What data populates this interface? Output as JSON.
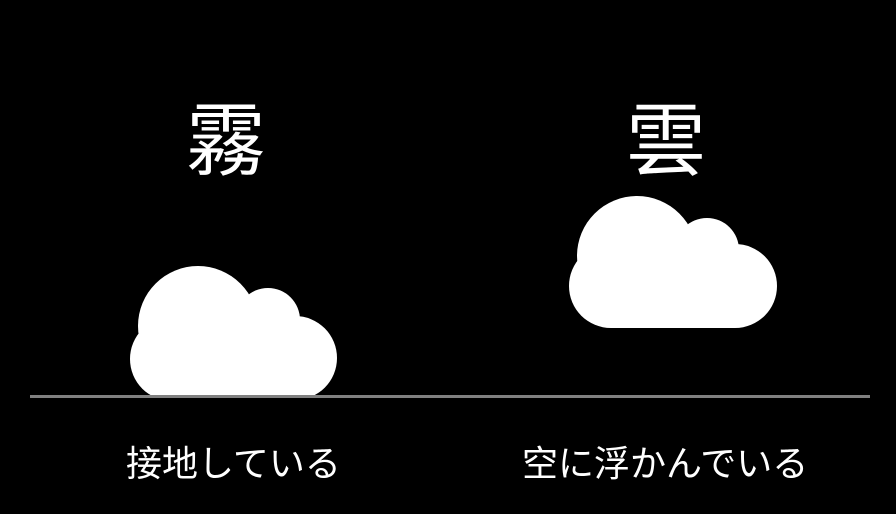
{
  "colors": {
    "background": "#000000",
    "text": "#ffffff",
    "cloud": "#ffffff",
    "ground": "#808080"
  },
  "left": {
    "title": "霧",
    "caption": "接地している",
    "icon": "cloud-icon"
  },
  "right": {
    "title": "雲",
    "caption": "空に浮かんでいる",
    "icon": "cloud-icon"
  }
}
